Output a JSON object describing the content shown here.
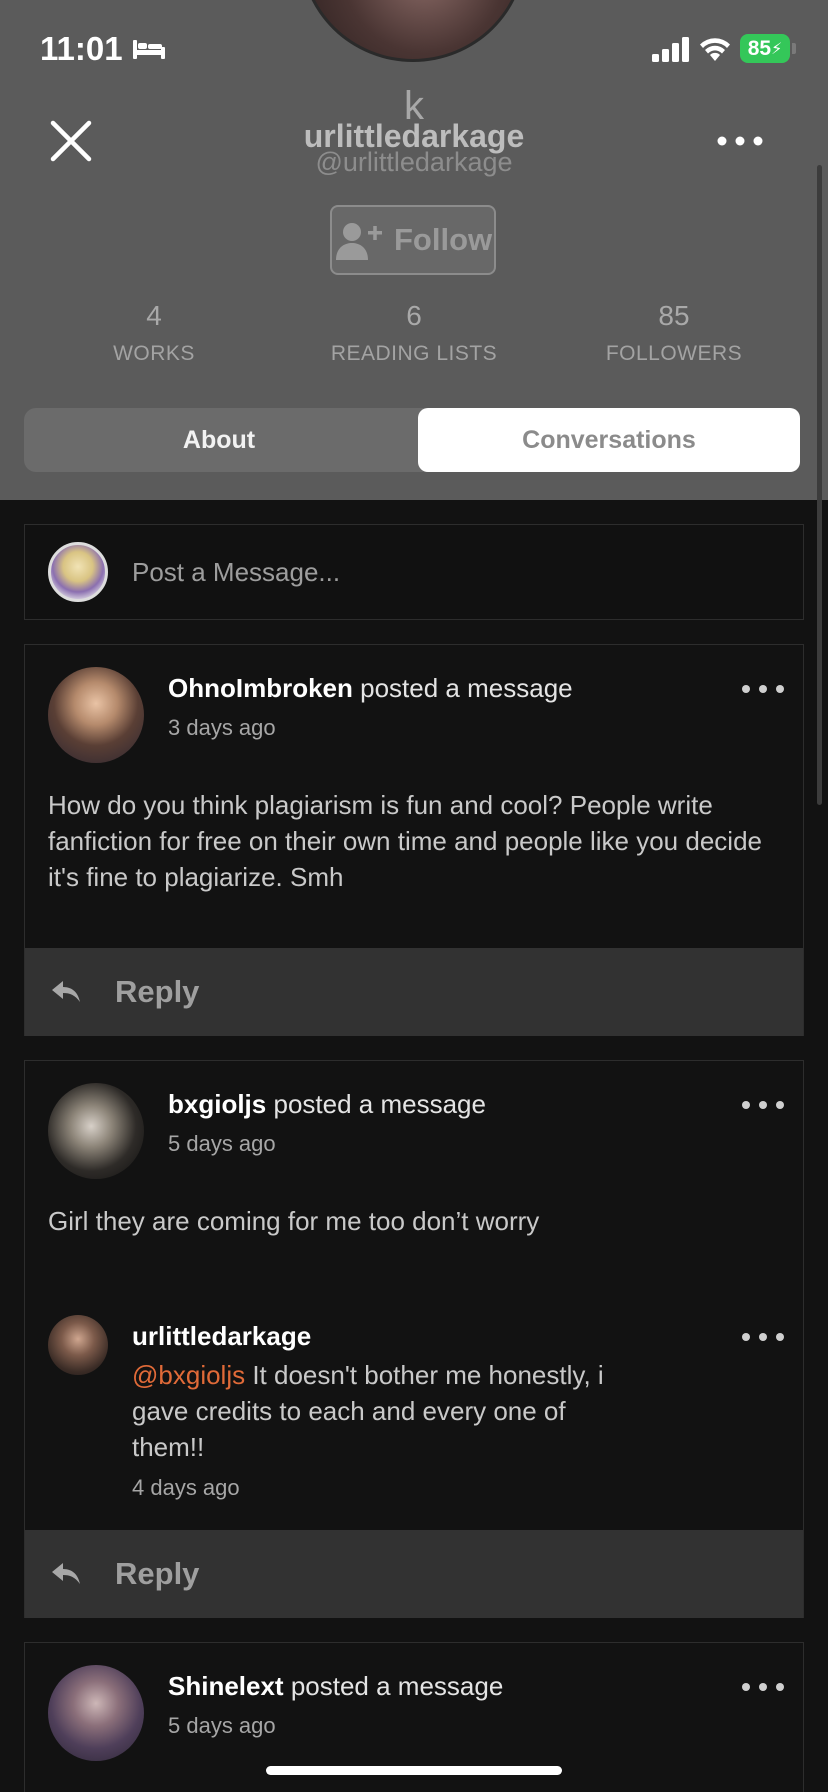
{
  "status_bar": {
    "time": "11:01",
    "battery": "85"
  },
  "header": {
    "k_letter": "k",
    "name": "urlittledarkage",
    "handle": "@urlittledarkage",
    "follow_label": "Follow"
  },
  "stats": [
    {
      "value": "4",
      "label": "WORKS"
    },
    {
      "value": "6",
      "label": "READING LISTS"
    },
    {
      "value": "85",
      "label": "FOLLOWERS"
    }
  ],
  "tabs": {
    "about": "About",
    "conversations": "Conversations"
  },
  "composer": {
    "placeholder": "Post a Message..."
  },
  "messages": [
    {
      "author": "OhnoImbroken",
      "action": "posted a message",
      "time": "3 days ago",
      "body": "How do you think plagiarism is fun and cool? People write fanfiction for free on their own time and people like you decide it's fine to plagiarize. Smh",
      "reply_label": "Reply"
    },
    {
      "author": "bxgioljs",
      "action": "posted a message",
      "time": "5 days ago",
      "body": "Girl they are coming for me too don’t worry",
      "reply": {
        "author": "urlittledarkage",
        "mention": "@bxgioljs",
        "text": " It doesn't bother me honestly, i gave credits to each and every one of them!!",
        "time": "4 days ago"
      },
      "reply_label": "Reply"
    },
    {
      "author": "Shinelext",
      "action": "posted a message",
      "time": "5 days ago"
    }
  ],
  "colors": {
    "header_bg": "#5b5b5b",
    "feed_bg": "#121212",
    "mention": "#e06a38",
    "battery": "#34c759"
  }
}
